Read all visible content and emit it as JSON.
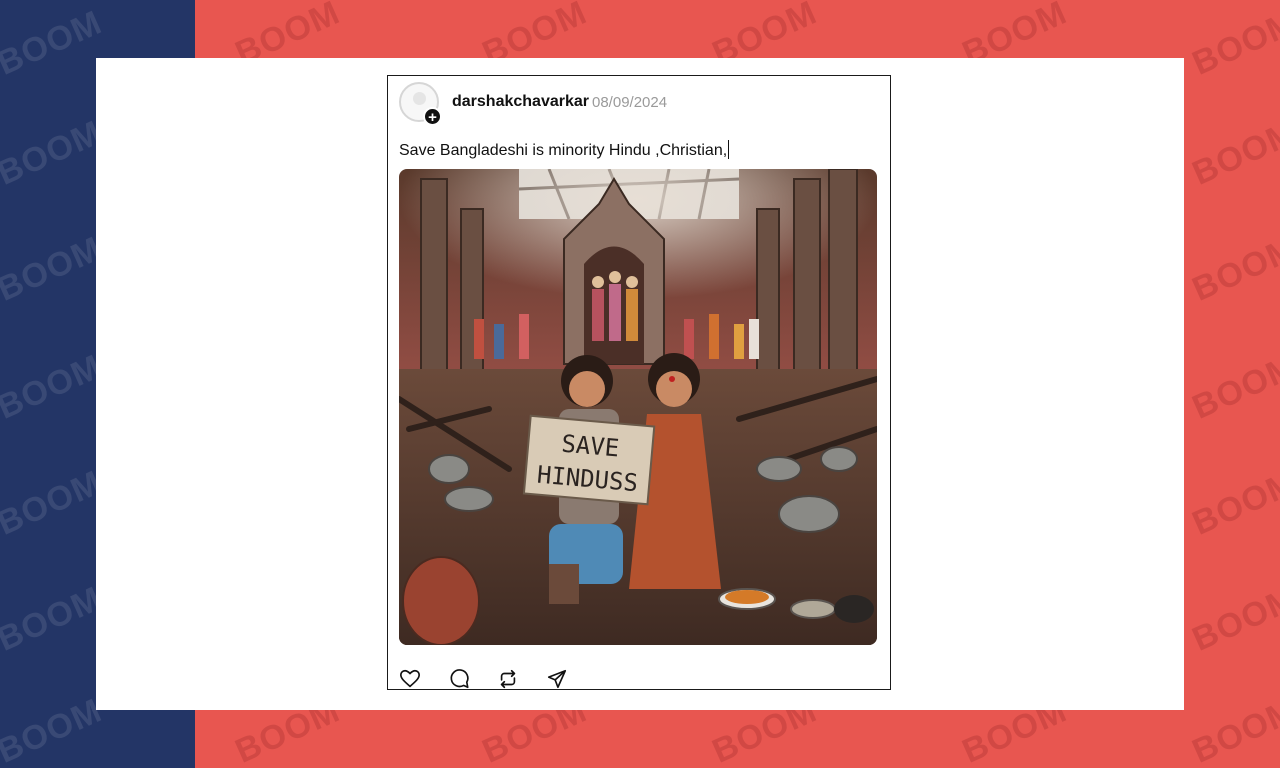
{
  "watermark": {
    "text": "BOOM"
  },
  "colors": {
    "left_panel": "#233566",
    "right_panel": "#e85650",
    "card": "#ffffff"
  },
  "post": {
    "username": "darshakchavarkar",
    "date": "08/09/2024",
    "caption": "Save Bangladeshi is minority Hindu ,Christian,",
    "image": {
      "sign_line1": "SAVE",
      "sign_line2": "HINDUSS"
    },
    "actions": [
      {
        "icon": "heart-icon"
      },
      {
        "icon": "comment-icon"
      },
      {
        "icon": "repost-icon"
      },
      {
        "icon": "share-icon"
      }
    ]
  }
}
